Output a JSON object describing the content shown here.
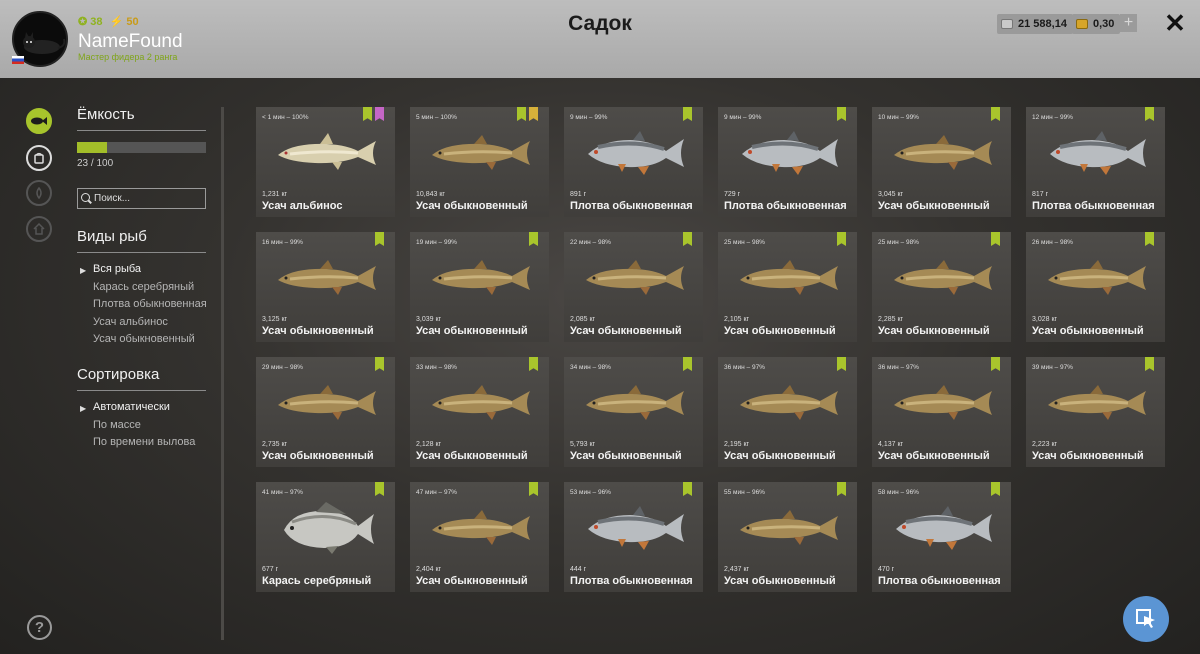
{
  "header": {
    "title": "Садок",
    "player": {
      "level": "38",
      "energy": "50",
      "name": "NameFound",
      "rank": "Мастер фидера 2 ранга"
    },
    "currency": [
      {
        "value": "21 588,14",
        "icon": "silver-coins-icon",
        "color": "#c9c9c9"
      },
      {
        "value": "0,30",
        "icon": "gold-coins-icon",
        "color": "#d6a52a"
      }
    ],
    "add_label": "+",
    "close_label": "✕"
  },
  "sidebar": {
    "capacity_title": "Ёмкость",
    "capacity_text": "23 / 100",
    "capacity_fraction": 0.23,
    "search_placeholder": "Поиск...",
    "species_title": "Виды рыб",
    "species": [
      {
        "label": "Вся рыба",
        "active": true
      },
      {
        "label": "Карась серебряный",
        "active": false
      },
      {
        "label": "Плотва обыкновенная",
        "active": false
      },
      {
        "label": "Усач альбинос",
        "active": false
      },
      {
        "label": "Усач обыкновенный",
        "active": false
      }
    ],
    "sort_title": "Сортировка",
    "sorts": [
      {
        "label": "Автоматически",
        "active": true
      },
      {
        "label": "По массе",
        "active": false
      },
      {
        "label": "По времени вылова",
        "active": false
      }
    ],
    "help_label": "?"
  },
  "fish": [
    {
      "time": "< 1 мин – 100%",
      "weight": "1,231 кг",
      "name": "Усач альбинос",
      "kind": "albino",
      "badges": [
        "green",
        "pink"
      ]
    },
    {
      "time": "5 мин – 100%",
      "weight": "10,843 кг",
      "name": "Усач обыкновенный",
      "kind": "barbel",
      "badges": [
        "green",
        "gold"
      ]
    },
    {
      "time": "9 мин – 99%",
      "weight": "891 г",
      "name": "Плотва обыкновенная",
      "kind": "roach",
      "badges": [
        "green"
      ]
    },
    {
      "time": "9 мин – 99%",
      "weight": "729 г",
      "name": "Плотва обыкновенная",
      "kind": "roach",
      "badges": [
        "green"
      ]
    },
    {
      "time": "10 мин – 99%",
      "weight": "3,045 кг",
      "name": "Усач обыкновенный",
      "kind": "barbel",
      "badges": [
        "green"
      ]
    },
    {
      "time": "12 мин – 99%",
      "weight": "817 г",
      "name": "Плотва обыкновенная",
      "kind": "roach",
      "badges": [
        "green"
      ]
    },
    {
      "time": "16 мин – 99%",
      "weight": "3,125 кг",
      "name": "Усач обыкновенный",
      "kind": "barbel",
      "badges": [
        "green"
      ]
    },
    {
      "time": "19 мин – 99%",
      "weight": "3,039 кг",
      "name": "Усач обыкновенный",
      "kind": "barbel",
      "badges": [
        "green"
      ]
    },
    {
      "time": "22 мин – 98%",
      "weight": "2,085 кг",
      "name": "Усач обыкновенный",
      "kind": "barbel",
      "badges": [
        "green"
      ]
    },
    {
      "time": "25 мин – 98%",
      "weight": "2,105 кг",
      "name": "Усач обыкновенный",
      "kind": "barbel",
      "badges": [
        "green"
      ]
    },
    {
      "time": "25 мин – 98%",
      "weight": "2,285 кг",
      "name": "Усач обыкновенный",
      "kind": "barbel",
      "badges": [
        "green"
      ]
    },
    {
      "time": "26 мин – 98%",
      "weight": "3,028 кг",
      "name": "Усач обыкновенный",
      "kind": "barbel",
      "badges": [
        "green"
      ]
    },
    {
      "time": "29 мин – 98%",
      "weight": "2,735 кг",
      "name": "Усач обыкновенный",
      "kind": "barbel",
      "badges": [
        "green"
      ]
    },
    {
      "time": "33 мин – 98%",
      "weight": "2,128 кг",
      "name": "Усач обыкновенный",
      "kind": "barbel",
      "badges": [
        "green"
      ]
    },
    {
      "time": "34 мин – 98%",
      "weight": "5,793 кг",
      "name": "Усач обыкновенный",
      "kind": "barbel",
      "badges": [
        "green"
      ]
    },
    {
      "time": "36 мин – 97%",
      "weight": "2,195 кг",
      "name": "Усач обыкновенный",
      "kind": "barbel",
      "badges": [
        "green"
      ]
    },
    {
      "time": "36 мин – 97%",
      "weight": "4,137 кг",
      "name": "Усач обыкновенный",
      "kind": "barbel",
      "badges": [
        "green"
      ]
    },
    {
      "time": "39 мин – 97%",
      "weight": "2,223 кг",
      "name": "Усач обыкновенный",
      "kind": "barbel",
      "badges": [
        "green"
      ]
    },
    {
      "time": "41 мин – 97%",
      "weight": "677 г",
      "name": "Карась серебряный",
      "kind": "carp",
      "badges": [
        "green"
      ]
    },
    {
      "time": "47 мин – 97%",
      "weight": "2,404 кг",
      "name": "Усач обыкновенный",
      "kind": "barbel",
      "badges": [
        "green"
      ]
    },
    {
      "time": "53 мин – 96%",
      "weight": "444 г",
      "name": "Плотва обыкновенная",
      "kind": "roach",
      "badges": [
        "green"
      ]
    },
    {
      "time": "55 мин – 96%",
      "weight": "2,437 кг",
      "name": "Усач обыкновенный",
      "kind": "barbel",
      "badges": [
        "green"
      ]
    },
    {
      "time": "58 мин – 96%",
      "weight": "470 г",
      "name": "Плотва обыкновенная",
      "kind": "roach",
      "badges": [
        "green"
      ]
    }
  ]
}
